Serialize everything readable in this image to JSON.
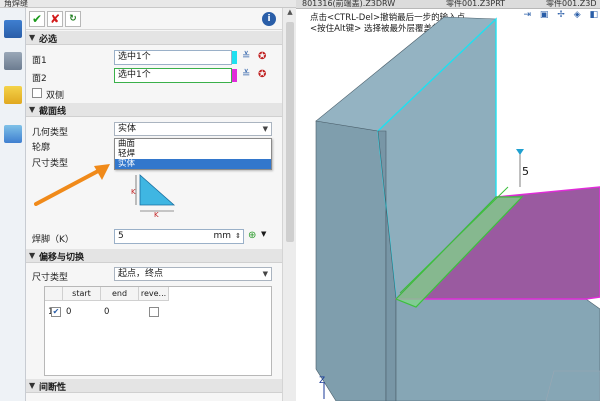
{
  "window": {
    "title": "角焊缝",
    "tabs": [
      "801316(前端盖).Z3DRW",
      "零件001.Z3PRT",
      "零件001.Z3D"
    ]
  },
  "toolbar": {
    "ok_label": "✔",
    "cancel_label": "✘",
    "apply_label": "↻",
    "info_label": "i"
  },
  "sections": {
    "required": "必选",
    "profile": "截面线",
    "offset": "偏移与切换",
    "gap": "间断性"
  },
  "required": {
    "face1_label": "面1",
    "face1_value": "选中1个",
    "face2_label": "面2",
    "face2_value": "选中1个",
    "two_sided_label": "双侧"
  },
  "profile": {
    "geometry_type_label": "几何类型",
    "geometry_type_value": "实体",
    "contour_label": "轮廓",
    "dim_type_label": "尺寸类型",
    "dropdown_options": [
      "曲面",
      "轻焊",
      "实体"
    ],
    "dropdown_selected_index": 2,
    "diagram_label_k1": "K",
    "diagram_label_k2": "K",
    "leg_label": "焊脚（K）",
    "leg_value": "5",
    "leg_unit": "mm"
  },
  "offset": {
    "dim_type_label": "尺寸类型",
    "dim_type_value": "起点，终点",
    "table_headers": [
      "",
      "start",
      "end",
      "reve..."
    ],
    "rows": [
      {
        "index": "1",
        "checked": true,
        "start": "0",
        "end": "0",
        "reverse": false
      }
    ]
  },
  "viewport": {
    "hint_line1": "点击<CTRL-Del>撤销最后一步的输入点。",
    "hint_line2": "<按住Alt键> 选择被最外层覆盖的实体。",
    "dimension_label": "5",
    "axis_label": "Z"
  },
  "colors": {
    "face_cyan": "#1fe0f0",
    "face_magenta": "#e02cd8",
    "weld_green": "#3cc03c",
    "selection_blue": "#3377cc",
    "arrow_orange": "#f08a1a",
    "model_gray": "#87a7b7",
    "face_purple": "#9a5aa0"
  }
}
